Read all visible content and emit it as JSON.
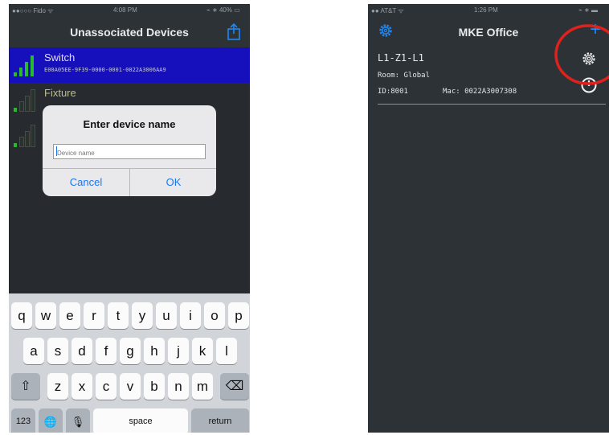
{
  "left_phone": {
    "status": {
      "carrier": "●●○○○ Fido ᯤ",
      "time": "4:08 PM",
      "battery": "⌁ ∗ 40% ▭"
    },
    "nav": {
      "title": "Unassociated Devices"
    },
    "devices": [
      {
        "name": "Switch",
        "id": "E00A05EE-9F39-0000-0001-0022A3006AA9"
      },
      {
        "name": "Fixture",
        "id": ""
      }
    ],
    "dialog": {
      "title": "Enter device name",
      "placeholder": "Device name",
      "cancel": "Cancel",
      "ok": "OK"
    },
    "keyboard": {
      "row1": [
        "q",
        "w",
        "e",
        "r",
        "t",
        "y",
        "u",
        "i",
        "o",
        "p"
      ],
      "row2": [
        "a",
        "s",
        "d",
        "f",
        "g",
        "h",
        "j",
        "k",
        "l"
      ],
      "row3": [
        "z",
        "x",
        "c",
        "v",
        "b",
        "n",
        "m"
      ],
      "shift": "⇧",
      "backspace": "⌫",
      "numbers": "123",
      "globe": "🌐",
      "mic": "🎙",
      "space": "space",
      "return": "return"
    }
  },
  "right_phone": {
    "status": {
      "carrier": "●● AT&T ᯤ",
      "time": "1:26 PM",
      "battery": "⌁ ∗ ▬"
    },
    "nav": {
      "title": "MKE Office",
      "add": "+"
    },
    "device": {
      "name": "L1-Z1-L1",
      "room": "Room: Global",
      "id": "ID:8001",
      "mac": "Mac: 0022A3007308"
    }
  },
  "colors": {
    "background": "#2d3236",
    "selected_row": "#1a12d6",
    "signal_green": "#2fd23a",
    "link_blue": "#1877f2",
    "highlight_circle": "#e0211c"
  },
  "icons": [
    "share-icon",
    "gear-icon",
    "power-icon",
    "add-icon"
  ]
}
